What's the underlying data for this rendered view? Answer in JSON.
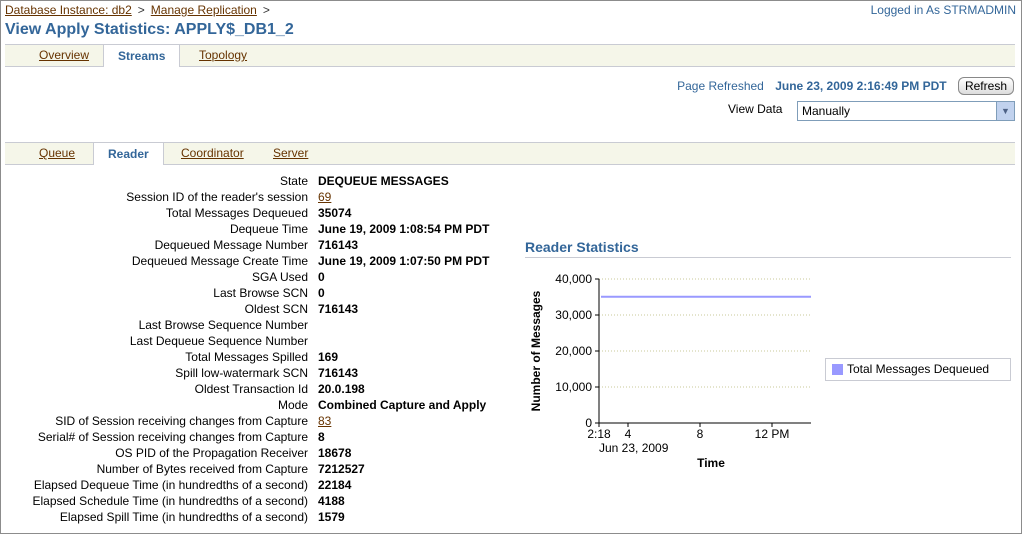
{
  "breadcrumb": {
    "item1": "Database Instance: db2",
    "item2": "Manage Replication",
    "sep": ">"
  },
  "user": {
    "logged_in": "Logged in As STRMADMIN"
  },
  "page": {
    "title": "View Apply Statistics: APPLY$_DB1_2"
  },
  "tabs": {
    "overview": "Overview",
    "streams": "Streams",
    "topology": "Topology"
  },
  "refresh": {
    "label": "Page Refreshed",
    "value": "June 23, 2009 2:16:49 PM PDT",
    "button": "Refresh"
  },
  "view_data": {
    "label": "View Data",
    "selected": "Manually"
  },
  "subtabs": {
    "queue": "Queue",
    "reader": "Reader",
    "coordinator": "Coordinator",
    "server": "Server"
  },
  "reader": {
    "rows": [
      {
        "k": "State",
        "v": "DEQUEUE MESSAGES"
      },
      {
        "k": "Session ID of the reader's session",
        "v": "69",
        "link": true
      },
      {
        "k": "Total Messages Dequeued",
        "v": "35074"
      },
      {
        "k": "Dequeue Time",
        "v": "June 19, 2009 1:08:54 PM PDT"
      },
      {
        "k": "Dequeued Message Number",
        "v": "716143"
      },
      {
        "k": "Dequeued Message Create Time",
        "v": "June 19, 2009 1:07:50 PM PDT"
      },
      {
        "k": "SGA Used",
        "v": "0"
      },
      {
        "k": "Last Browse SCN",
        "v": "0"
      },
      {
        "k": "Oldest SCN",
        "v": "716143"
      },
      {
        "k": "Last Browse Sequence Number",
        "v": ""
      },
      {
        "k": "Last Dequeue Sequence Number",
        "v": ""
      },
      {
        "k": "Total Messages Spilled",
        "v": "169"
      },
      {
        "k": "Spill low-watermark SCN",
        "v": "716143"
      },
      {
        "k": "Oldest Transaction Id",
        "v": "20.0.198"
      },
      {
        "k": "Mode",
        "v": "Combined Capture and Apply"
      },
      {
        "k": "SID of Session receiving changes from Capture",
        "v": "83",
        "link": true
      },
      {
        "k": "Serial# of Session receiving changes from Capture",
        "v": "8"
      },
      {
        "k": "OS PID of the Propagation Receiver",
        "v": "18678"
      },
      {
        "k": "Number of Bytes received from Capture",
        "v": "7212527"
      },
      {
        "k": "Elapsed Dequeue Time (in hundredths of a second)",
        "v": "22184"
      },
      {
        "k": "Elapsed Schedule Time (in hundredths of a second)",
        "v": "4188"
      },
      {
        "k": "Elapsed Spill Time (in hundredths of a second)",
        "v": "1579"
      }
    ]
  },
  "stats": {
    "title": "Reader Statistics"
  },
  "chart_data": {
    "type": "line",
    "ylabel": "Number of Messages",
    "xlabel": "Time",
    "ylim": [
      0,
      40000
    ],
    "yticks": [
      "0",
      "10,000",
      "20,000",
      "30,000",
      "40,000"
    ],
    "xticks": [
      "2:18",
      "4",
      "8",
      "12 PM"
    ],
    "xsublabel": "Jun 23, 2009",
    "grid": true,
    "legend_position": "right",
    "series": [
      {
        "name": "Total Messages Dequeued",
        "color": "#9999ff",
        "values": [
          35074,
          35074
        ]
      }
    ]
  }
}
